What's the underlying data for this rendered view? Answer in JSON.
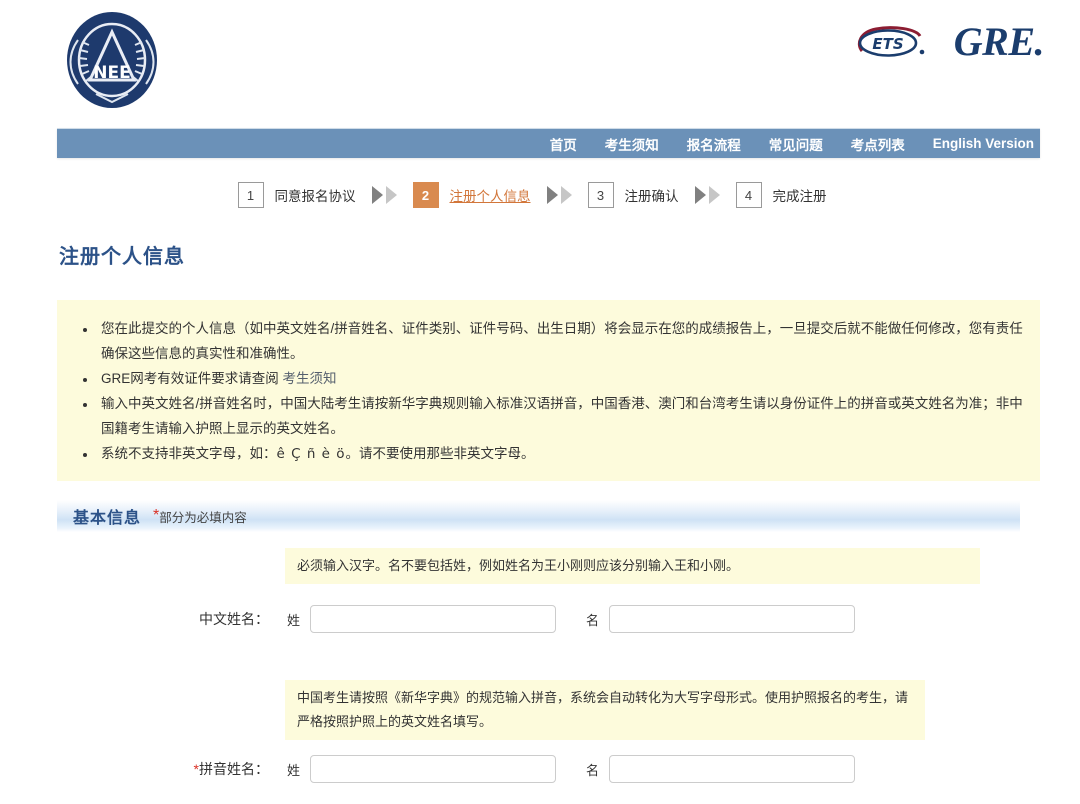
{
  "header": {
    "neea_logo_alt": "NEEA",
    "ets_logo_text": "ETS",
    "gre_logo_text": "GRE."
  },
  "nav": {
    "items": [
      {
        "label": "首页"
      },
      {
        "label": "考生须知"
      },
      {
        "label": "报名流程"
      },
      {
        "label": "常见问题"
      },
      {
        "label": "考点列表"
      },
      {
        "label": "English Version"
      }
    ]
  },
  "steps": [
    {
      "number": "1",
      "label": "同意报名协议",
      "active": false
    },
    {
      "number": "2",
      "label": "注册个人信息",
      "active": true
    },
    {
      "number": "3",
      "label": "注册确认",
      "active": false
    },
    {
      "number": "4",
      "label": "完成注册",
      "active": false
    }
  ],
  "page_title": "注册个人信息",
  "notice": {
    "bullet_1": "您在此提交的个人信息（如中英文姓名/拼音姓名、证件类别、证件号码、出生日期）将会显示在您的成绩报告上，一旦提交后就不能做任何修改，您有责任确保这些信息的真实性和准确性。",
    "bullet_2_text": "GRE网考有效证件要求请查阅 ",
    "bullet_2_link": "考生须知",
    "bullet_3": "输入中英文姓名/拼音姓名时，中国大陆考生请按新华字典规则输入标准汉语拼音，中国香港、澳门和台湾考生请以身份证件上的拼音或英文姓名为准；非中国籍考生请输入护照上显示的英文姓名。",
    "bullet_4_prefix": "系统不支持非英文字母，如：",
    "bullet_4_chars": "ê Ç ñ è ö",
    "bullet_4_suffix": "。请不要使用那些非英文字母。"
  },
  "section": {
    "title": "基本信息",
    "required_star": "*",
    "required_note": "部分为必填内容"
  },
  "form": {
    "hint_chinese_name": "必须输入汉字。名不要包括姓，例如姓名为王小刚则应该分别输入王和小刚。",
    "hint_pinyin_name": "中国考生请按照《新华字典》的规范输入拼音，系统会自动转化为大写字母形式。使用护照报名的考生，请严格按照护照上的英文姓名填写。",
    "chinese_name": {
      "label": "中文姓名：",
      "surname_label": "姓",
      "given_label": "名",
      "surname_value": "",
      "given_value": "",
      "required": false
    },
    "pinyin_name": {
      "label": "拼音姓名：",
      "required_star": "*",
      "surname_label": "姓",
      "given_label": "名",
      "surname_value": "",
      "given_value": "",
      "required": true
    }
  },
  "colors": {
    "nav_bg": "#6b91b8",
    "brand_navy": "#1b3d6d",
    "title_blue": "#2c5288",
    "accent_orange": "#d98a4f",
    "notice_yellow": "#fdfbdc",
    "required_red": "#d93025"
  }
}
